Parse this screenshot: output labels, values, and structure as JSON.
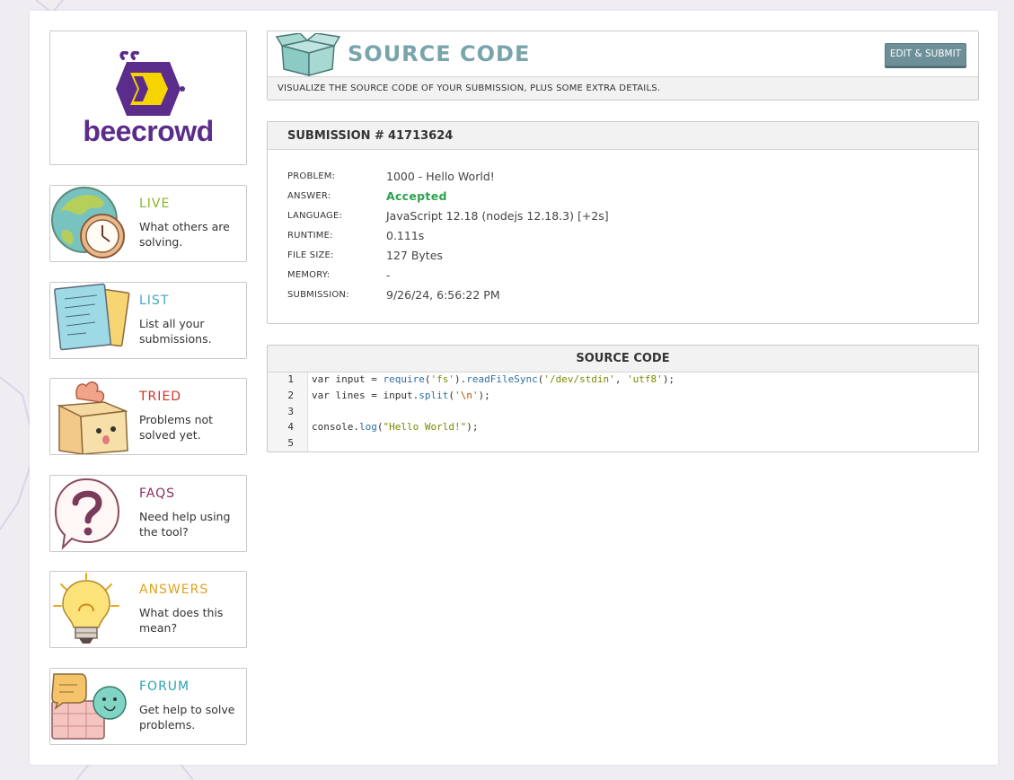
{
  "brand": {
    "name": "beecrowd",
    "color": "#5b2c8c",
    "accent": "#f5d400"
  },
  "nav": [
    {
      "id": "live",
      "title": "LIVE",
      "desc": "What others are solving.",
      "color": "#8ab428",
      "icon": "globe-clock-icon"
    },
    {
      "id": "list",
      "title": "LIST",
      "desc": "List all your submissions.",
      "color": "#43a6c4",
      "icon": "papers-icon"
    },
    {
      "id": "tried",
      "title": "TRIED",
      "desc": "Problems not solved yet.",
      "color": "#d2342a",
      "icon": "box-icon"
    },
    {
      "id": "faqs",
      "title": "FAQS",
      "desc": "Need help using the tool?",
      "color": "#8b2d5a",
      "icon": "question-bubble-icon"
    },
    {
      "id": "answers",
      "title": "ANSWERS",
      "desc": "What does this mean?",
      "color": "#e0a21a",
      "icon": "lightbulb-icon"
    },
    {
      "id": "forum",
      "title": "FORUM",
      "desc": "Get help to solve problems.",
      "color": "#2aa3b0",
      "icon": "chat-bubbles-icon"
    }
  ],
  "header": {
    "title": "SOURCE CODE",
    "button": "EDIT & SUBMIT",
    "subtitle": "VISUALIZE THE SOURCE CODE OF YOUR SUBMISSION, PLUS SOME EXTRA DETAILS."
  },
  "submission": {
    "title_prefix": "SUBMISSION #",
    "id": "41713624",
    "fields": [
      {
        "label": "PROBLEM:",
        "value": "1000 - Hello World!"
      },
      {
        "label": "ANSWER:",
        "value": "Accepted"
      },
      {
        "label": "LANGUAGE:",
        "value": "JavaScript 12.18 (nodejs 12.18.3) [+2s]"
      },
      {
        "label": "RUNTIME:",
        "value": "0.111s"
      },
      {
        "label": "FILE SIZE:",
        "value": "127 Bytes"
      },
      {
        "label": "MEMORY:",
        "value": "-"
      },
      {
        "label": "SUBMISSION:",
        "value": "9/26/24, 6:56:22 PM"
      }
    ]
  },
  "source": {
    "title": "SOURCE CODE",
    "lines": [
      "var input = require('fs').readFileSync('/dev/stdin', 'utf8');",
      "var lines = input.split('\\n');",
      "",
      "console.log(\"Hello World!\");",
      ""
    ]
  }
}
